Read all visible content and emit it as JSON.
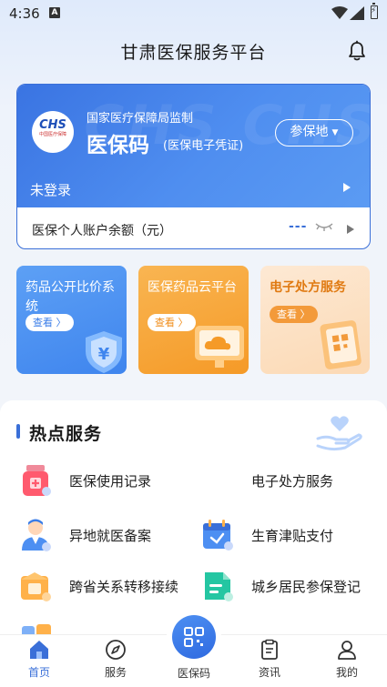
{
  "status_bar": {
    "time": "4:36",
    "notif_letter": "A"
  },
  "header": {
    "title": "甘肃医保服务平台",
    "bell_icon": "bell-icon"
  },
  "card": {
    "supervisor": "国家医疗保障局监制",
    "logo_text": "CHS",
    "logo_sub": "中国医疗保障",
    "title": "医保码",
    "subtitle": "(医保电子凭证)",
    "region_button": "参保地",
    "login_status": "未登录",
    "balance_label": "医保个人账户余额（元）",
    "balance_value": "---"
  },
  "tiles": [
    {
      "title": "药品公开比价系统",
      "button": "查看 〉"
    },
    {
      "title": "医保药品云平台",
      "button": "查看 〉"
    },
    {
      "title": "电子处方服务",
      "button": "查看 〉"
    }
  ],
  "hot_services": {
    "title": "热点服务",
    "items": [
      {
        "label": "医保使用记录",
        "icon": "medicine-bottle-icon"
      },
      {
        "label": "电子处方服务",
        "icon": "prescription-icon"
      },
      {
        "label": "异地就医备案",
        "icon": "doctor-icon"
      },
      {
        "label": "生育津贴支付",
        "icon": "calendar-icon"
      },
      {
        "label": "跨省关系转移接续",
        "icon": "transfer-box-icon"
      },
      {
        "label": "城乡居民参保登记",
        "icon": "registration-icon"
      }
    ]
  },
  "nav": {
    "items": [
      {
        "label": "首页",
        "icon": "home-icon",
        "active": true
      },
      {
        "label": "服务",
        "icon": "compass-icon"
      },
      {
        "label": "医保码",
        "icon": "qr-code-icon"
      },
      {
        "label": "资讯",
        "icon": "news-icon"
      },
      {
        "label": "我的",
        "icon": "profile-icon"
      }
    ]
  },
  "colors": {
    "primary": "#3a6fd8",
    "orange": "#f59a27"
  }
}
